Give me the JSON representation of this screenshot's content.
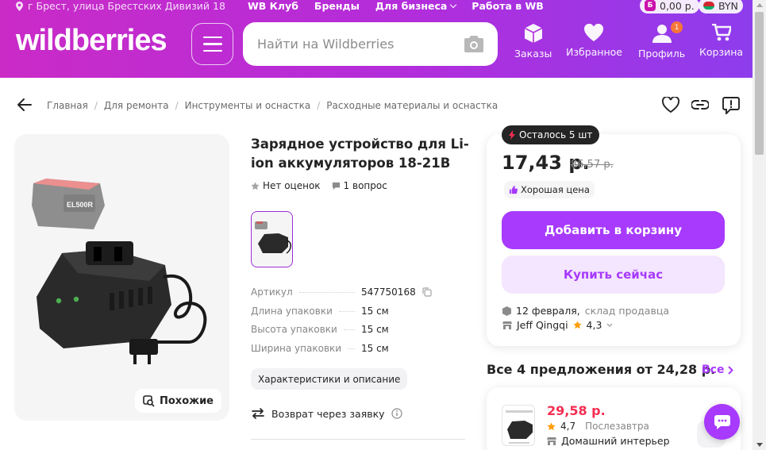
{
  "topbar": {
    "location": "г Брест, улица Брестских Дивизий 18",
    "links": [
      "WB Клуб",
      "Бренды",
      "Для бизнеса",
      "Работа в WB"
    ],
    "balance": "0,00 р.",
    "balance_badge": "Б",
    "currency": "BYN"
  },
  "header": {
    "logo": "wildberries",
    "search_placeholder": "Найти на Wildberries",
    "nav": {
      "orders": "Заказы",
      "favorites": "Избранное",
      "profile": "Профиль",
      "profile_badge": "1",
      "cart": "Корзина"
    }
  },
  "breadcrumbs": [
    "Главная",
    "Для ремонта",
    "Инструменты и оснастка",
    "Расходные материалы и оснастка"
  ],
  "product": {
    "title": "Зарядное устройство для Li-ion аккумуляторов 18-21В",
    "rating_text": "Нет оценок",
    "questions_text": "1 вопрос",
    "battery_label": "EL500R",
    "similar_label": "Похожие",
    "specs": [
      {
        "key": "Артикул",
        "value": "547750168"
      },
      {
        "key": "Длина упаковки",
        "value": "15 см"
      },
      {
        "key": "Высота упаковки",
        "value": "15 см"
      },
      {
        "key": "Ширина упаковки",
        "value": "15 см"
      }
    ],
    "details_chip": "Характеристики и описание",
    "return_text": "Возврат через заявку"
  },
  "buy": {
    "stock": "Осталось 5 шт",
    "price": "17,43 р.",
    "old_price": "86,57 р.",
    "good_price": "Хорошая цена",
    "add_to_cart": "Добавить в корзину",
    "buy_now": "Купить сейчас",
    "delivery_date": "12 февраля,",
    "delivery_source": "склад продавца",
    "seller": "Jeff Qingqi",
    "seller_rating": "4,3"
  },
  "offers": {
    "title": "Все 4 предложения от 24,28 р.",
    "all_label": "Все",
    "first": {
      "price": "29,58 р.",
      "rating": "4,7",
      "delivery": "Послезавтра",
      "seller": "Домашний интерьер"
    }
  },
  "colors": {
    "accent": "#a73afd",
    "header_start": "#ca2bc7",
    "header_end": "#8e3ded",
    "sale_red": "#f42e52",
    "star": "#ff9f0a"
  }
}
